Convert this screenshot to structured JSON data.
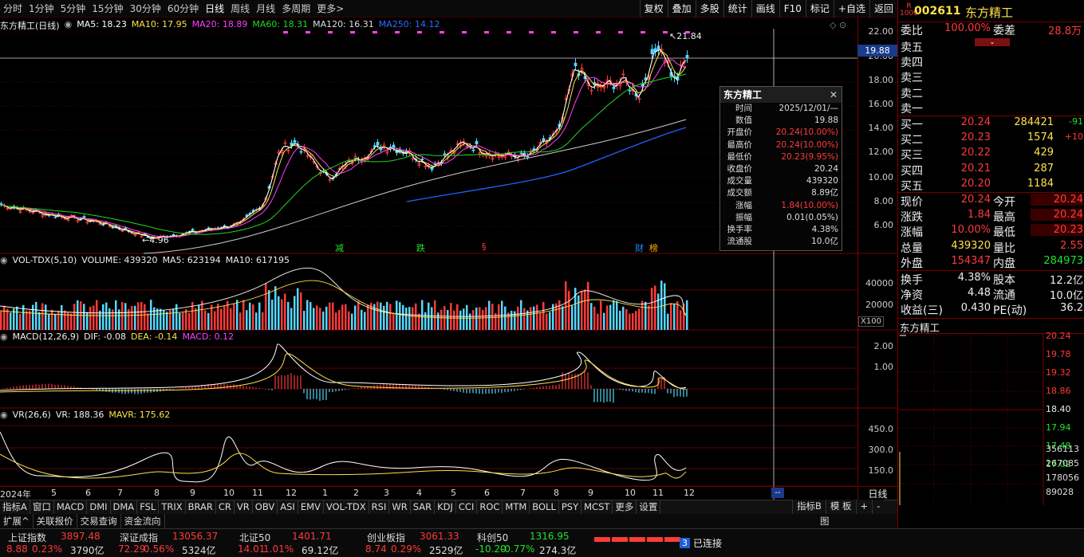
{
  "toolbar": {
    "periods": [
      "分时",
      "1分钟",
      "5分钟",
      "15分钟",
      "30分钟",
      "60分钟",
      "日线",
      "周线",
      "月线",
      "多周期",
      "更多>"
    ],
    "active_period": "日线",
    "tools": [
      "复权",
      "叠加",
      "多股",
      "统计",
      "画线",
      "F10",
      "标记",
      "+自选",
      "返回"
    ]
  },
  "main_legend": {
    "name": "东方精工(日线)",
    "ma5": "MA5: 18.23",
    "ma10": "MA10: 17.95",
    "ma20": "MA20: 18.89",
    "ma60": "MA60: 18.31",
    "ma120": "MA120: 16.31",
    "ma250": "MA250: 14.12"
  },
  "colors": {
    "ma5": "#ffffff",
    "ma10": "#ffe14a",
    "ma20": "#ff40ff",
    "ma60": "#22d822",
    "ma120": "#cccccc",
    "ma250": "#2060ff",
    "up": "#ff3a3a",
    "down": "#54d8ff",
    "grid": "#5a0000"
  },
  "price_axis": [
    "22.00",
    "20.00",
    "18.00",
    "16.00",
    "14.00",
    "12.00",
    "10.00",
    "8.00",
    "6.00"
  ],
  "price_current": "19.88",
  "annotations": {
    "high": "21.84",
    "low": "4.96"
  },
  "event_marks": [
    "减",
    "跌",
    "§",
    "财",
    "榜"
  ],
  "vol_legend": {
    "name": "VOL-TDX(5,10)",
    "volume": "VOLUME: 439320",
    "ma5": "MA5: 623194",
    "ma10": "MA10: 617195"
  },
  "vol_axis": [
    "40000",
    "20000"
  ],
  "vol_unit": "X100",
  "macd_legend": {
    "name": "MACD(12,26,9)",
    "dif": "DIF: -0.08",
    "dea": "DEA: -0.14",
    "macd": "MACD: 0.12"
  },
  "macd_axis": [
    "2.00",
    "1.00"
  ],
  "vr_legend": {
    "name": "VR(26,6)",
    "vr": "VR: 188.36",
    "mavr": "MAVR: 175.62"
  },
  "vr_axis": [
    "450.0",
    "300.0",
    "150.0"
  ],
  "x_axis": [
    "2024年",
    "5",
    "6",
    "7",
    "8",
    "9",
    "10",
    "11",
    "12",
    "1",
    "2",
    "3",
    "4",
    "5",
    "6",
    "7",
    "8",
    "9",
    "10",
    "11",
    "12"
  ],
  "x_axis_right": "日线",
  "infobox": {
    "title": "东方精工",
    "rows": [
      [
        "时间",
        "2025/12/01/—"
      ],
      [
        "数值",
        "19.88"
      ],
      [
        "开盘价",
        "20.24(10.00%)"
      ],
      [
        "最高价",
        "20.24(10.00%)"
      ],
      [
        "最低价",
        "20.23(9.95%)"
      ],
      [
        "收盘价",
        "20.24"
      ],
      [
        "成交量",
        "439320"
      ],
      [
        "成交额",
        "8.89亿"
      ],
      [
        "涨幅",
        "1.84(10.00%)"
      ],
      [
        "振幅",
        "0.01(0.05%)"
      ],
      [
        "换手率",
        "4.38%"
      ],
      [
        "流通股",
        "10.0亿"
      ]
    ]
  },
  "bottom_tabs": [
    "指标A",
    "窗口",
    "MACD",
    "DMI",
    "DMA",
    "FSL",
    "TRIX",
    "BRAR",
    "CR",
    "VR",
    "OBV",
    "ASI",
    "EMV",
    "VOL-TDX",
    "RSI",
    "WR",
    "SAR",
    "KDJ",
    "CCI",
    "ROC",
    "MTM",
    "BOLL",
    "PSY",
    "MCST",
    "更多",
    "设置"
  ],
  "bottom_tabs_right": [
    "指标B",
    "模 板",
    "+",
    "-"
  ],
  "sub_tabs": [
    "扩展^",
    "关联报价",
    "交易查询",
    "资金流向"
  ],
  "sub_tab_right": "图",
  "status": {
    "indices": [
      {
        "name": "上证指数",
        "value": "3897.48",
        "chg": "8.88",
        "pct": "0.23%",
        "amt": "3790亿"
      },
      {
        "name": "深证成指",
        "value": "13056.37",
        "chg": "72.29",
        "pct": "0.56%",
        "amt": "5324亿"
      },
      {
        "name": "北证50",
        "value": "1401.71",
        "chg": "14.01",
        "pct": "1.01%",
        "amt": "69.12亿"
      },
      {
        "name": "创业板指",
        "value": "3061.33",
        "chg": "8.74",
        "pct": "0.29%",
        "amt": "2529亿"
      },
      {
        "name": "科创50",
        "value": "1316.95",
        "chg": "-10.20",
        "pct": "-0.77%",
        "amt": "274.3亿"
      }
    ],
    "connection": "已连接",
    "conn_count": "3"
  },
  "quote": {
    "code": "002611",
    "name": "东方精工",
    "badge": "R",
    "wb_label": "委比",
    "wb": "100.00%",
    "wc_label": "委差",
    "wc": "28.8万",
    "sells": [
      [
        "卖五",
        ""
      ],
      [
        "卖四",
        ""
      ],
      [
        "卖三",
        ""
      ],
      [
        "卖二",
        ""
      ],
      [
        "卖一",
        ""
      ]
    ],
    "buys": [
      [
        "买一",
        "20.24",
        "284421",
        "-91"
      ],
      [
        "买二",
        "20.23",
        "1574",
        "+10"
      ],
      [
        "买三",
        "20.22",
        "429",
        ""
      ],
      [
        "买四",
        "20.21",
        "287",
        ""
      ],
      [
        "买五",
        "20.20",
        "1184",
        ""
      ]
    ],
    "stats": [
      [
        "现价",
        "20.24",
        "今开",
        "20.24"
      ],
      [
        "涨跌",
        "1.84",
        "最高",
        "20.24"
      ],
      [
        "涨幅",
        "10.00%",
        "最低",
        "20.23"
      ],
      [
        "总量",
        "439320",
        "量比",
        "2.55"
      ],
      [
        "外盘",
        "154347",
        "内盘",
        "284973"
      ]
    ],
    "stats2": [
      [
        "换手",
        "4.38%",
        "股本",
        "12.2亿"
      ],
      [
        "净资",
        "4.48",
        "流通",
        "10.0亿"
      ],
      [
        "收益(三)",
        "0.430",
        "PE(动)",
        "36.2"
      ]
    ],
    "mini_title": "东方精工",
    "mini_prices": [
      "20.24",
      "19.78",
      "19.32",
      "18.86",
      "18.40",
      "17.94",
      "17.48",
      "17.02"
    ],
    "mini_vols": [
      "356113",
      "267085",
      "178056",
      "89028"
    ]
  }
}
